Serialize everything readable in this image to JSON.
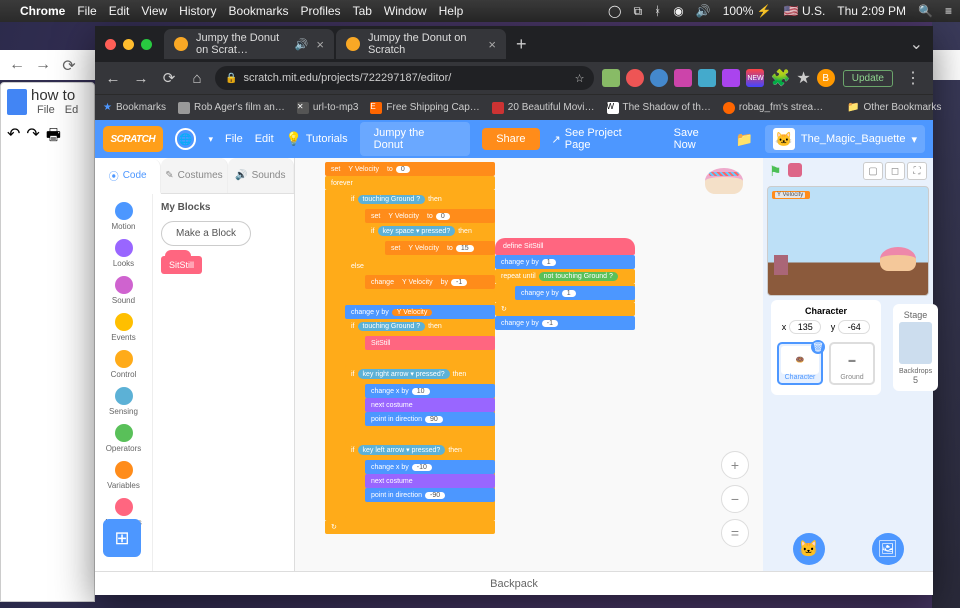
{
  "mac": {
    "app": "Chrome",
    "menus": [
      "File",
      "Edit",
      "View",
      "History",
      "Bookmarks",
      "Profiles",
      "Tab",
      "Window",
      "Help"
    ],
    "right": {
      "battery": "100%",
      "flag": "U.S.",
      "day": "Thu",
      "time": "2:09 PM"
    }
  },
  "chrome": {
    "tabs": [
      {
        "title": "Jumpy the Donut on Scrat…",
        "active": true,
        "audio": true
      },
      {
        "title": "Jumpy the Donut on Scratch",
        "active": false
      }
    ],
    "url": "scratch.mit.edu/projects/722297187/editor/",
    "update": "Update",
    "bookmarks": [
      "Bookmarks",
      "Rob Ager's film an…",
      "url-to-mp3",
      "Free Shipping Cap…",
      "20 Beautiful Movi…",
      "The Shadow of th…",
      "robag_fm's strea…"
    ],
    "otherBookmarks": "Other Bookmarks"
  },
  "docs": {
    "title": "how to",
    "menus": [
      "File",
      "Ed"
    ]
  },
  "scratch": {
    "menu": {
      "file": "File",
      "edit": "Edit",
      "tutorials": "Tutorials",
      "project": "Jumpy the Donut",
      "share": "Share",
      "seeProject": "See Project Page",
      "save": "Save Now",
      "user": "The_Magic_Baguette"
    },
    "tabs": {
      "code": "Code",
      "costumes": "Costumes",
      "sounds": "Sounds"
    },
    "categories": [
      {
        "name": "Motion",
        "color": "#4c97ff"
      },
      {
        "name": "Looks",
        "color": "#9966ff"
      },
      {
        "name": "Sound",
        "color": "#cf63cf"
      },
      {
        "name": "Events",
        "color": "#ffbf00"
      },
      {
        "name": "Control",
        "color": "#ffab19"
      },
      {
        "name": "Sensing",
        "color": "#5cb1d6"
      },
      {
        "name": "Operators",
        "color": "#59c059"
      },
      {
        "name": "Variables",
        "color": "#ff8c1a"
      },
      {
        "name": "My Blocks",
        "color": "#ff6680"
      }
    ],
    "palette": {
      "heading": "My Blocks",
      "makeBlock": "Make a Block",
      "customBlock": "SitStill"
    },
    "scripts": {
      "stack1": {
        "setYVel0": {
          "op": "set",
          "var": "Y Velocity",
          "to": "0"
        },
        "forever": "forever",
        "ifTouchGround": {
          "if": "if",
          "cond": "touching Ground ?",
          "then": "then"
        },
        "setYVel0b": {
          "op": "set",
          "var": "Y Velocity",
          "to": "0"
        },
        "ifKeySpace": {
          "if": "if",
          "key": "key space ▾ pressed?",
          "then": "then"
        },
        "setYVel15": {
          "op": "set",
          "var": "Y Velocity",
          "to": "15"
        },
        "else": "else",
        "changeYVel": {
          "op": "change",
          "var": "Y Velocity",
          "by": "-1"
        },
        "changeYbyVar": {
          "op": "change y by",
          "var": "Y Velocity"
        },
        "ifTouchGround2": {
          "if": "if",
          "cond": "touching Ground ?",
          "then": "then"
        },
        "sitstill": "SitStill",
        "ifRight": {
          "if": "if",
          "key": "key right arrow ▾ pressed?",
          "then": "then"
        },
        "changeX10": {
          "op": "change x by",
          "val": "10"
        },
        "nextCostume": "next costume",
        "pointDir90": {
          "op": "point in direction",
          "val": "90"
        },
        "ifLeft": {
          "if": "if",
          "key": "key left arrow ▾ pressed?",
          "then": "then"
        },
        "changeXneg10": {
          "op": "change x by",
          "val": "-10"
        },
        "nextCostume2": "next costume",
        "pointDirNeg90": {
          "op": "point in direction",
          "val": "-90"
        }
      },
      "stack2": {
        "define": "define  SitStill",
        "changeY1": {
          "op": "change y by",
          "val": "1"
        },
        "repeatUntil": {
          "op": "repeat until",
          "cond": "not  touching Ground ?"
        },
        "changeY1b": {
          "op": "change y by",
          "val": "1"
        },
        "changeYneg1": {
          "op": "change y by",
          "val": "-1"
        }
      }
    },
    "spriteInfo": {
      "label": "Character",
      "x": "x",
      "xval": "135",
      "y": "y",
      "yval": "-64"
    },
    "sprites": [
      {
        "name": "Character"
      },
      {
        "name": "Ground"
      }
    ],
    "stage": {
      "label": "Stage",
      "backdrops": "Backdrops",
      "count": "5"
    },
    "varMonitor": {
      "name": "Y Velocity",
      "val": ""
    },
    "backpack": "Backpack"
  }
}
